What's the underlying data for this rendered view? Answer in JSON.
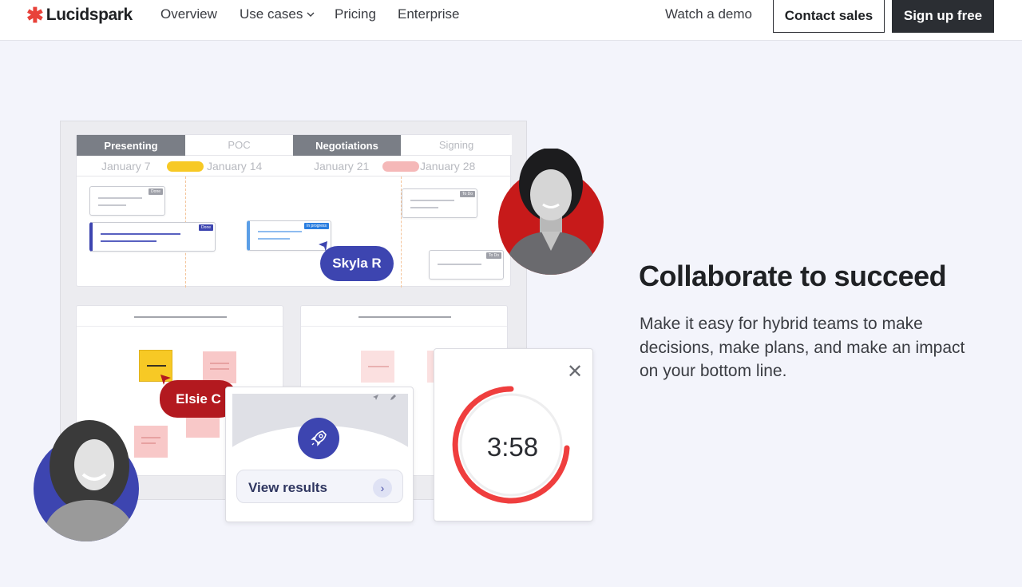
{
  "nav": {
    "logo": "Lucidspark",
    "links": [
      "Overview",
      "Use cases",
      "Pricing",
      "Enterprise"
    ],
    "watch_demo": "Watch a demo",
    "contact_sales": "Contact sales",
    "sign_up": "Sign up free"
  },
  "board": {
    "phases": [
      "Presenting",
      "POC",
      "Negotiations",
      "Signing"
    ],
    "dates": [
      "January 7",
      "January 14",
      "January 21",
      "January 28"
    ],
    "card_tags": [
      "Done",
      "Done",
      "In progress",
      "To Do",
      "To Do"
    ],
    "cursor_1": "Skyla R",
    "cursor_2": "Elsie C"
  },
  "survey": {
    "button": "View results",
    "arrow": "›"
  },
  "timer": {
    "close": "✕",
    "value": "3:58"
  },
  "hero": {
    "headline": "Collaborate to succeed",
    "body": "Make it easy for hybrid teams to make decisions, make plans, and make an impact on your bottom line."
  },
  "colors": {
    "accent_red": "#e8423a",
    "brand_blue": "#3d45b0",
    "dark": "#2b2e33"
  }
}
